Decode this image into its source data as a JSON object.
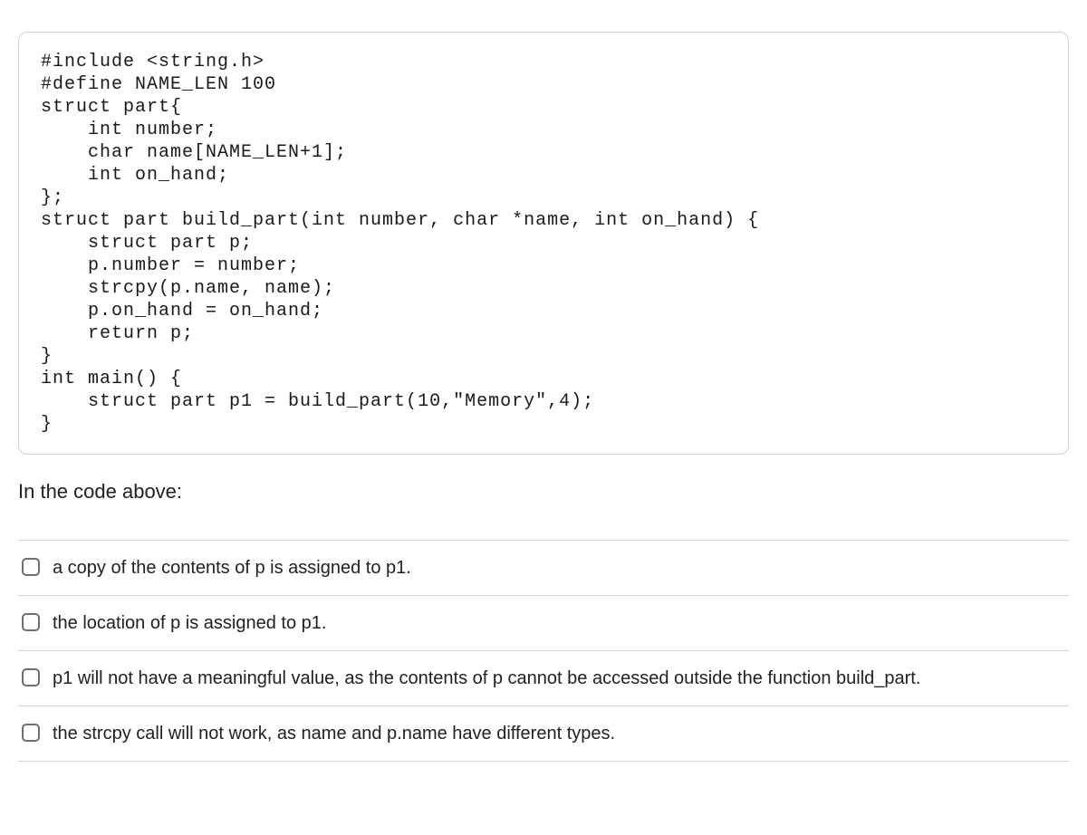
{
  "code": "#include <string.h>\n#define NAME_LEN 100\nstruct part{\n    int number;\n    char name[NAME_LEN+1];\n    int on_hand;\n};\nstruct part build_part(int number, char *name, int on_hand) {\n    struct part p;\n    p.number = number;\n    strcpy(p.name, name);\n    p.on_hand = on_hand;\n    return p;\n}\nint main() {\n    struct part p1 = build_part(10,\"Memory\",4);\n}",
  "prompt": "In the code above:",
  "options": [
    {
      "label": "a copy of the contents of p is assigned to p1."
    },
    {
      "label": "the location of p is assigned to p1."
    },
    {
      "label": "p1 will not have a meaningful value, as the contents of p cannot be accessed outside the function build_part."
    },
    {
      "label": "the strcpy call will not work, as name and p.name have different types."
    }
  ]
}
